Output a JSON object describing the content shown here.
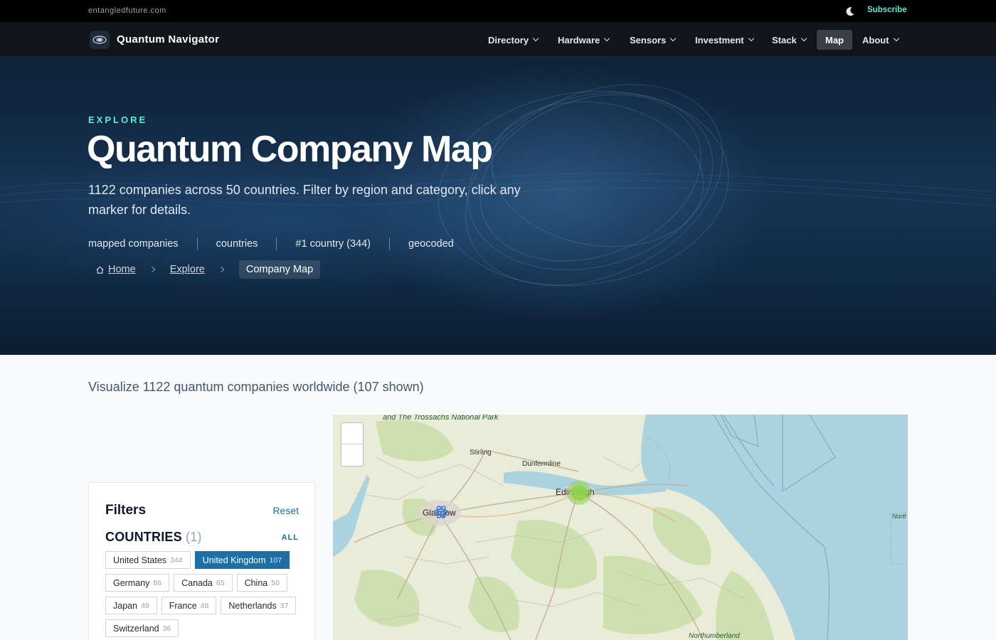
{
  "topbar": {
    "domain": "entangledfuture.com",
    "subscribe": "Subscribe"
  },
  "brand": {
    "name": "Quantum Navigator"
  },
  "nav": {
    "items": [
      {
        "label": "Directory"
      },
      {
        "label": "Hardware"
      },
      {
        "label": "Sensors"
      },
      {
        "label": "Investment"
      },
      {
        "label": "Stack"
      },
      {
        "label": "Map",
        "active": true
      },
      {
        "label": "About"
      }
    ]
  },
  "hero": {
    "eyebrow": "EXPLORE",
    "title": "Quantum Company Map",
    "lead": "1122 companies across 50 countries. Filter by region and category, click any marker for details.",
    "stats": [
      "mapped companies",
      "countries",
      "#1 country (344)",
      "geocoded"
    ]
  },
  "breadcrumb": {
    "home": "Home",
    "explore": "Explore",
    "current": "Company Map"
  },
  "main": {
    "subtitle": "Visualize 1122 quantum companies worldwide (107 shown)"
  },
  "filters": {
    "title": "Filters",
    "reset": "Reset",
    "countries_label": "COUNTRIES",
    "countries_count": "(1)",
    "all": "ALL",
    "countries": [
      {
        "name": "United States",
        "count": "344",
        "selected": false
      },
      {
        "name": "United Kingdom",
        "count": "107",
        "selected": true
      },
      {
        "name": "Germany",
        "count": "86",
        "selected": false
      },
      {
        "name": "Canada",
        "count": "65",
        "selected": false
      },
      {
        "name": "China",
        "count": "50",
        "selected": false
      },
      {
        "name": "Japan",
        "count": "49",
        "selected": false
      },
      {
        "name": "France",
        "count": "48",
        "selected": false
      },
      {
        "name": "Netherlands",
        "count": "37",
        "selected": false
      },
      {
        "name": "Switzerland",
        "count": "36",
        "selected": false
      }
    ]
  },
  "map": {
    "labels": {
      "trossachs": "and The Trossachs National Park",
      "stirling": "Stirling",
      "dunfermline": "Dunfermline",
      "edinburgh": "Edinburgh",
      "glasgow": "Glasgow",
      "northumberland": "Northumberland",
      "north_sea": "North of F Deep Pro M A"
    },
    "colors": {
      "sea": "#aad3df",
      "land": "#e8ecd8",
      "green": "#cfe0b0",
      "cluster_green": "#8ed14a",
      "cluster_blue": "#3a7bd5"
    }
  },
  "icons": {
    "logo": "atom-logo-icon",
    "moon": "moon-icon",
    "home": "home-icon",
    "chevron": "chevron-down-icon"
  }
}
